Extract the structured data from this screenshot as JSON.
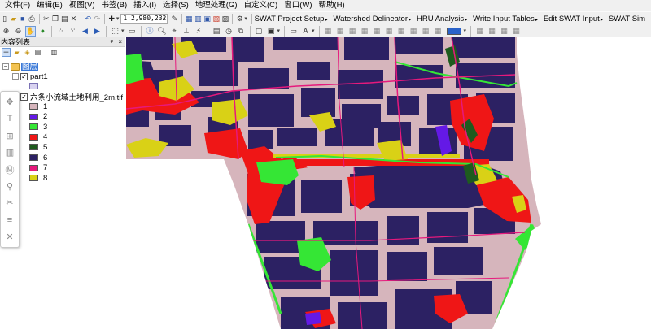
{
  "menu": [
    "文件(F)",
    "编辑(E)",
    "视图(V)",
    "书签(B)",
    "插入(I)",
    "选择(S)",
    "地理处理(G)",
    "自定义(C)",
    "窗口(W)",
    "帮助(H)"
  ],
  "toolbar": {
    "scale": "1:2,980,232,239",
    "swat_menus": [
      "SWAT Project Setup",
      "Watershed Delineator",
      "HRU Analysis",
      "Write Input Tables",
      "Edit SWAT Input",
      "SWAT Sim"
    ]
  },
  "toc": {
    "title": "内容列表",
    "pin_glyph": "ᵠ",
    "close_glyph": "×",
    "layers_label": "图层",
    "group_name": "part1",
    "raster_name": "六条小流域土地利用_2m.tif",
    "legend": [
      {
        "value": "1",
        "color": "#d6b5bc"
      },
      {
        "value": "2",
        "color": "#6419e6"
      },
      {
        "value": "3",
        "color": "#35e635"
      },
      {
        "value": "4",
        "color": "#ef1616"
      },
      {
        "value": "5",
        "color": "#1e5b1e"
      },
      {
        "value": "6",
        "color": "#2c2163"
      },
      {
        "value": "7",
        "color": "#e6197c"
      },
      {
        "value": "8",
        "color": "#d9d116"
      }
    ]
  },
  "map": {
    "colors": {
      "background": "#d6b5bc",
      "dark": "#2c2163",
      "red": "#ef1616",
      "yellow": "#d9d116",
      "green": "#35e635",
      "darkgreen": "#1e5b1e",
      "purple": "#6419e6",
      "magenta": "#e6197c"
    }
  }
}
